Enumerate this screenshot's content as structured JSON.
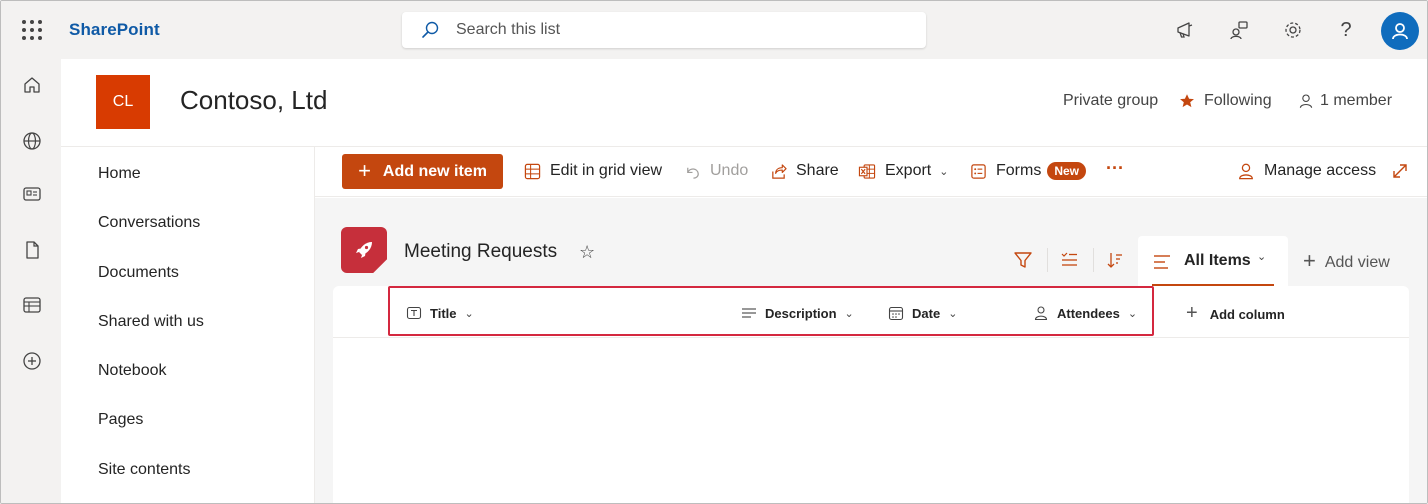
{
  "suite": {
    "brand": "SharePoint",
    "search_placeholder": "Search this list"
  },
  "site": {
    "logo_initials": "CL",
    "title": "Contoso, Ltd",
    "privacy": "Private group",
    "following": "Following",
    "members": "1 member"
  },
  "nav": {
    "items": [
      "Home",
      "Conversations",
      "Documents",
      "Shared with us",
      "Notebook",
      "Pages",
      "Site contents"
    ]
  },
  "commands": {
    "add_new_item": "Add new item",
    "edit_grid": "Edit in grid view",
    "undo": "Undo",
    "share": "Share",
    "export": "Export",
    "forms": "Forms",
    "forms_badge": "New",
    "more": "···",
    "manage_access": "Manage access"
  },
  "list": {
    "title": "Meeting Requests",
    "view": "All Items",
    "add_view": "Add view",
    "columns": [
      "Title",
      "Description",
      "Date",
      "Attendees"
    ],
    "add_column": "Add column"
  },
  "colors": {
    "brand_blue": "#0f5aa6",
    "accent_orange": "#c4470f",
    "site_logo": "#d83b01",
    "highlight_red": "#d4283f",
    "list_icon": "#c62f3b"
  }
}
